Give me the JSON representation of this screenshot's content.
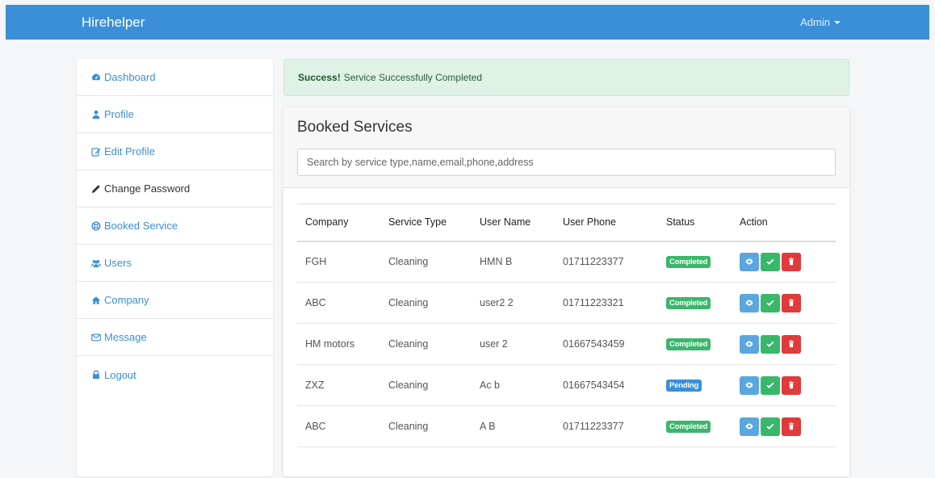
{
  "app": {
    "brand": "Hirehelper",
    "user_menu": "Admin"
  },
  "sidebar": {
    "items": [
      {
        "label": "Dashboard",
        "icon": "tachometer-icon"
      },
      {
        "label": "Profile",
        "icon": "user-icon"
      },
      {
        "label": "Edit Profile",
        "icon": "edit-icon"
      },
      {
        "label": "Change Password",
        "icon": "pencil-icon"
      },
      {
        "label": "Booked Service",
        "icon": "life-ring-icon"
      },
      {
        "label": "Users",
        "icon": "users-icon"
      },
      {
        "label": "Company",
        "icon": "home-icon"
      },
      {
        "label": "Message",
        "icon": "envelope-icon"
      },
      {
        "label": "Logout",
        "icon": "lock-icon"
      }
    ]
  },
  "alert": {
    "strong": "Success!",
    "text": "Service Successfully Completed"
  },
  "card": {
    "title": "Booked Services",
    "search_placeholder": "Search by service type,name,email,phone,address"
  },
  "table": {
    "headers": [
      "Company",
      "Service Type",
      "User Name",
      "User Phone",
      "Status",
      "Action"
    ],
    "rows": [
      {
        "company": "FGH",
        "service": "Cleaning",
        "user": "HMN B",
        "phone": "01711223377",
        "status": "Completed"
      },
      {
        "company": "ABC",
        "service": "Cleaning",
        "user": "user2 2",
        "phone": "01711223321",
        "status": "Completed"
      },
      {
        "company": "HM motors",
        "service": "Cleaning",
        "user": "user 2",
        "phone": "01667543459",
        "status": "Completed"
      },
      {
        "company": "ZXZ",
        "service": "Cleaning",
        "user": "Ac b",
        "phone": "01667543454",
        "status": "Pending"
      },
      {
        "company": "ABC",
        "service": "Cleaning",
        "user": "A B",
        "phone": "01711223377",
        "status": "Completed"
      }
    ]
  },
  "colors": {
    "primary": "#3a8fd8",
    "completed": "#39b76a",
    "pending": "#3a8fd8",
    "danger": "#e03a3a",
    "info": "#5aa7e0"
  }
}
